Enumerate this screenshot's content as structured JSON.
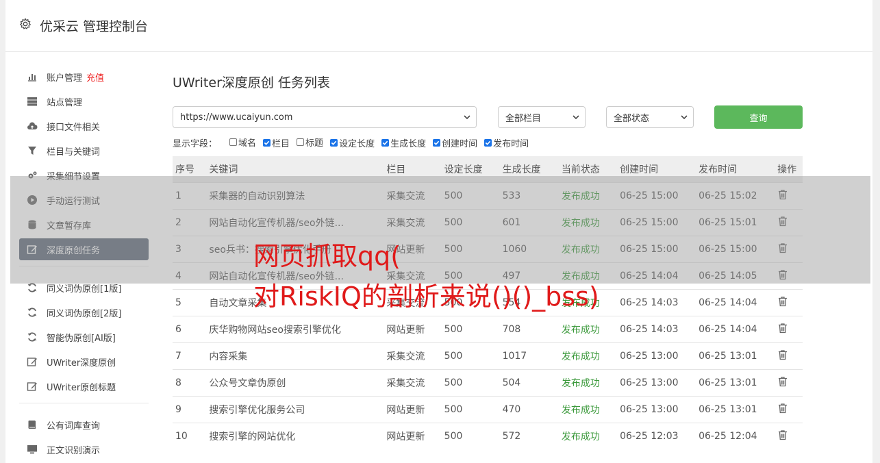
{
  "header": {
    "title": "优采云 管理控制台",
    "icon": "gear-icon"
  },
  "sidebar": {
    "items": [
      {
        "label": "账户管理",
        "tag": "充值",
        "icon": "bar-chart-icon"
      },
      {
        "label": "站点管理",
        "icon": "server-icon"
      },
      {
        "label": "接口文件相关",
        "icon": "cloud-upload-icon"
      },
      {
        "label": "栏目与关键词",
        "icon": "filter-icon"
      },
      {
        "label": "采集细节设置",
        "icon": "gears-icon"
      },
      {
        "label": "手动运行测试",
        "icon": "play-icon"
      },
      {
        "label": "文章暂存库",
        "icon": "database-icon"
      },
      {
        "label": "深度原创任务",
        "icon": "edit-icon",
        "active": true
      }
    ],
    "items2": [
      {
        "label": "同义词伪原创[1版]",
        "icon": "refresh-icon"
      },
      {
        "label": "同义词伪原创[2版]",
        "icon": "refresh-icon"
      },
      {
        "label": "智能伪原创[AI版]",
        "icon": "refresh-icon"
      },
      {
        "label": "UWriter深度原创",
        "icon": "edit-icon"
      },
      {
        "label": "UWriter原创标题",
        "icon": "edit-icon"
      }
    ],
    "items3": [
      {
        "label": "公有词库查询",
        "icon": "book-icon"
      },
      {
        "label": "正文识别演示",
        "icon": "monitor-icon"
      }
    ]
  },
  "main": {
    "title": "UWriter深度原创 任务列表",
    "site_select": "https://www.ucaiyun.com",
    "column_select": "全部栏目",
    "status_select": "全部状态",
    "query_button": "查询",
    "fields_label": "显示字段：",
    "fields": [
      {
        "label": "域名",
        "checked": false
      },
      {
        "label": "栏目",
        "checked": true
      },
      {
        "label": "标题",
        "checked": false
      },
      {
        "label": "设定长度",
        "checked": true
      },
      {
        "label": "生成长度",
        "checked": true
      },
      {
        "label": "创建时间",
        "checked": true
      },
      {
        "label": "发布时间",
        "checked": true
      }
    ],
    "table": {
      "headers": [
        "序号",
        "关键词",
        "栏目",
        "设定长度",
        "生成长度",
        "当前状态",
        "创建时间",
        "发布时间",
        "操作"
      ],
      "rows": [
        [
          "1",
          "采集器的自动识别算法",
          "采集交流",
          "500",
          "533",
          "发布成功",
          "06-25 15:00",
          "06-25 15:02"
        ],
        [
          "2",
          "网站自动化宣传机器/seo外链...",
          "采集交流",
          "500",
          "601",
          "发布成功",
          "06-25 15:00",
          "06-25 15:01"
        ],
        [
          "3",
          "seo兵书：搜索引擎优化手册",
          "网站更新",
          "500",
          "1060",
          "发布成功",
          "06-25 15:00",
          "06-25 15:00"
        ],
        [
          "4",
          "网站自动化宣传机器/seo外链...",
          "采集交流",
          "500",
          "497",
          "发布成功",
          "06-25 14:04",
          "06-25 14:05"
        ],
        [
          "5",
          "自动文章采集",
          "采集交流",
          "500",
          "554",
          "发布成功",
          "06-25 14:03",
          "06-25 14:04"
        ],
        [
          "6",
          "庆华购物网站seo搜索引擎优化",
          "网站更新",
          "500",
          "708",
          "发布成功",
          "06-25 14:03",
          "06-25 14:04"
        ],
        [
          "7",
          "内容采集",
          "采集交流",
          "500",
          "1017",
          "发布成功",
          "06-25 13:00",
          "06-25 13:01"
        ],
        [
          "8",
          "公众号文章伪原创",
          "采集交流",
          "500",
          "504",
          "发布成功",
          "06-25 13:00",
          "06-25 13:01"
        ],
        [
          "9",
          "搜索引擎优化服务公司",
          "网站更新",
          "500",
          "470",
          "发布成功",
          "06-25 13:00",
          "06-25 13:01"
        ],
        [
          "10",
          "搜索引擎的网站优化",
          "网站更新",
          "500",
          "572",
          "发布成功",
          "06-25 12:03",
          "06-25 12:04"
        ]
      ]
    }
  },
  "watermark": {
    "line1": "网页抓取qq(",
    "line2": "对RiskIQ的剖析来说()()_bss)"
  },
  "colors": {
    "accent": "#5cb85c",
    "active_nav": "#5d6978",
    "success": "#3c9a3c",
    "watermark": "#e01a1a"
  }
}
